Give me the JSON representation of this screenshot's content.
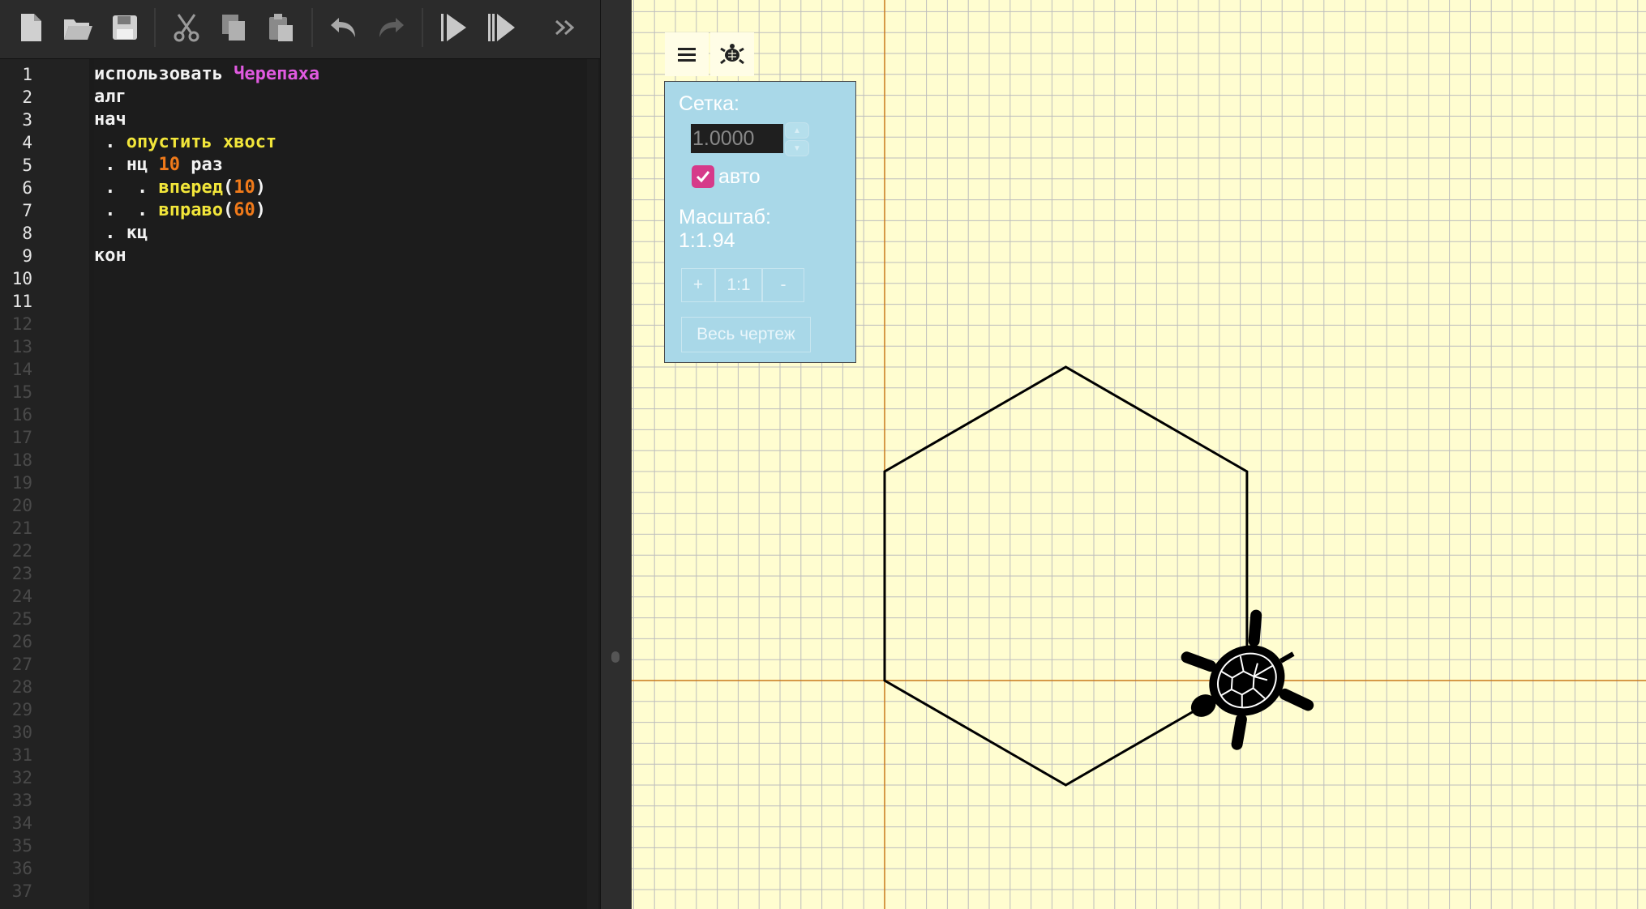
{
  "toolbar": {
    "buttons": [
      "new-file",
      "open-folder",
      "save",
      "cut",
      "copy",
      "paste",
      "undo",
      "redo",
      "run",
      "step",
      "more"
    ]
  },
  "editor": {
    "line_numbers": [
      "1",
      "2",
      "3",
      "4",
      "5",
      "6",
      "7",
      "8",
      "9",
      "10",
      "11",
      "12",
      "13",
      "14",
      "15",
      "16",
      "17",
      "18",
      "19",
      "20",
      "21",
      "22",
      "23",
      "24",
      "25",
      "26",
      "27",
      "28",
      "29",
      "30",
      "31",
      "32",
      "33",
      "34",
      "35",
      "36",
      "37"
    ],
    "lines": [
      [
        {
          "t": "использовать ",
          "c": "kw"
        },
        {
          "t": "Черепаха",
          "c": "mod"
        }
      ],
      [
        {
          "t": "алг",
          "c": "kw"
        }
      ],
      [
        {
          "t": "нач",
          "c": "kw"
        }
      ],
      [
        {
          "t": " . ",
          "c": "kw"
        },
        {
          "t": "опустить хвост",
          "c": "cmd"
        }
      ],
      [
        {
          "t": " . нц ",
          "c": "kw"
        },
        {
          "t": "10",
          "c": "num"
        },
        {
          "t": " раз",
          "c": "kw"
        }
      ],
      [
        {
          "t": " .  . ",
          "c": "kw"
        },
        {
          "t": "вперед",
          "c": "cmd"
        },
        {
          "t": "(",
          "c": "kw"
        },
        {
          "t": "10",
          "c": "num"
        },
        {
          "t": ")",
          "c": "kw"
        }
      ],
      [
        {
          "t": " .  . ",
          "c": "kw"
        },
        {
          "t": "вправо",
          "c": "cmd"
        },
        {
          "t": "(",
          "c": "kw"
        },
        {
          "t": "60",
          "c": "num"
        },
        {
          "t": ")",
          "c": "kw"
        }
      ],
      [
        {
          "t": " . кц",
          "c": "kw"
        }
      ],
      [
        {
          "t": "кон",
          "c": "kw"
        }
      ],
      [],
      []
    ],
    "active_line_count": 11
  },
  "canvas": {
    "menu_icon": "hamburger-icon",
    "turtle_icon": "turtle-icon",
    "panel": {
      "grid_label": "Сетка:",
      "grid_value": "1.0000",
      "auto_label": "авто",
      "auto_checked": true,
      "scale_label": "Масштаб:",
      "scale_value": "1:1.94",
      "zoom_in": "+",
      "zoom_reset": "1:1",
      "zoom_out": "-",
      "whole_drawing": "Весь чертеж"
    }
  },
  "colors": {
    "canvas_bg": "#fffdd0",
    "grid": "#bdbdbd",
    "axes": "#c97a1a",
    "path": "#000000",
    "panel_bg": "#a9d8e8",
    "checkbox": "#d63a8a"
  }
}
